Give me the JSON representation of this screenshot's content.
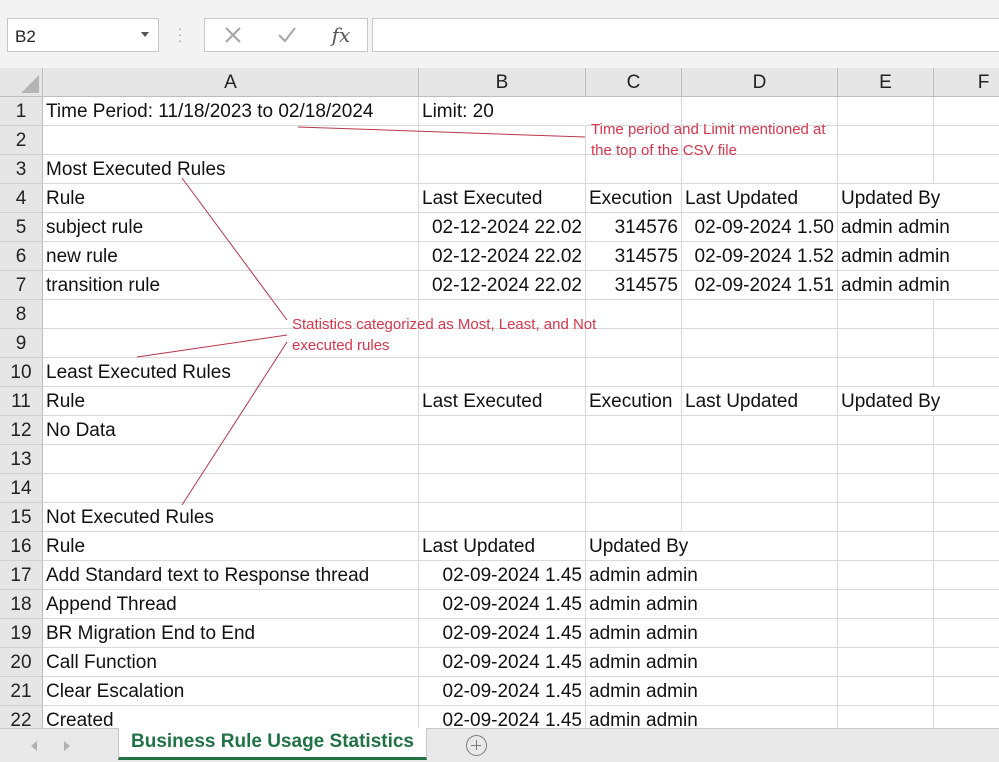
{
  "formula_bar": {
    "name_box": "B2",
    "fx_label": "fx",
    "formula_value": ""
  },
  "columns": [
    "A",
    "B",
    "C",
    "D",
    "E",
    "F"
  ],
  "rows": {
    "r1": {
      "num": "1",
      "a": "Time Period: 11/18/2023 to 02/18/2024",
      "b": "Limit: 20"
    },
    "r2": {
      "num": "2"
    },
    "r3": {
      "num": "3",
      "a": "Most Executed Rules"
    },
    "r4": {
      "num": "4",
      "a": "Rule",
      "b": "Last Executed",
      "c": "Execution",
      "d": "Last Updated",
      "e": "Updated By"
    },
    "r5": {
      "num": "5",
      "a": "subject rule",
      "b": "02-12-2024 22.02",
      "c": "314576",
      "d": "02-09-2024 1.50",
      "e": "admin admin"
    },
    "r6": {
      "num": "6",
      "a": "new rule",
      "b": "02-12-2024 22.02",
      "c": "314575",
      "d": "02-09-2024 1.52",
      "e": "admin admin"
    },
    "r7": {
      "num": "7",
      "a": "transition rule",
      "b": "02-12-2024 22.02",
      "c": "314575",
      "d": "02-09-2024 1.51",
      "e": "admin admin"
    },
    "r8": {
      "num": "8"
    },
    "r9": {
      "num": "9"
    },
    "r10": {
      "num": "10",
      "a": "Least Executed Rules"
    },
    "r11": {
      "num": "11",
      "a": "Rule",
      "b": "Last Executed",
      "c": "Execution",
      "d": "Last Updated",
      "e": "Updated By"
    },
    "r12": {
      "num": "12",
      "a": "No Data"
    },
    "r13": {
      "num": "13"
    },
    "r14": {
      "num": "14"
    },
    "r15": {
      "num": "15",
      "a": "Not Executed Rules"
    },
    "r16": {
      "num": "16",
      "a": "Rule",
      "b": "Last Updated",
      "c": "Updated By"
    },
    "r17": {
      "num": "17",
      "a": "Add Standard text to Response thread",
      "b": "02-09-2024 1.45",
      "c": "admin admin"
    },
    "r18": {
      "num": "18",
      "a": "Append Thread",
      "b": "02-09-2024 1.45",
      "c": "admin admin"
    },
    "r19": {
      "num": "19",
      "a": "BR Migration End to End",
      "b": "02-09-2024 1.45",
      "c": "admin admin"
    },
    "r20": {
      "num": "20",
      "a": "Call Function",
      "b": "02-09-2024 1.45",
      "c": "admin admin"
    },
    "r21": {
      "num": "21",
      "a": "Clear Escalation",
      "b": "02-09-2024 1.45",
      "c": "admin admin"
    },
    "r22": {
      "num": "22",
      "a": "Created",
      "b": "02-09-2024 1.45",
      "c": "admin admin"
    }
  },
  "annotations": {
    "time_period_note": [
      "Time period and Limit mentioned at",
      "the top of the CSV file"
    ],
    "statistics_note": [
      "Statistics categorized as Most, Least, and Not",
      "executed rules"
    ],
    "color": "#d6364c"
  },
  "sheet_tabs": {
    "active": "Business Rule Usage Statistics"
  },
  "colors": {
    "accent": "#217346",
    "header_bg": "#e6e6e6",
    "gridline": "#d9d9d9"
  }
}
